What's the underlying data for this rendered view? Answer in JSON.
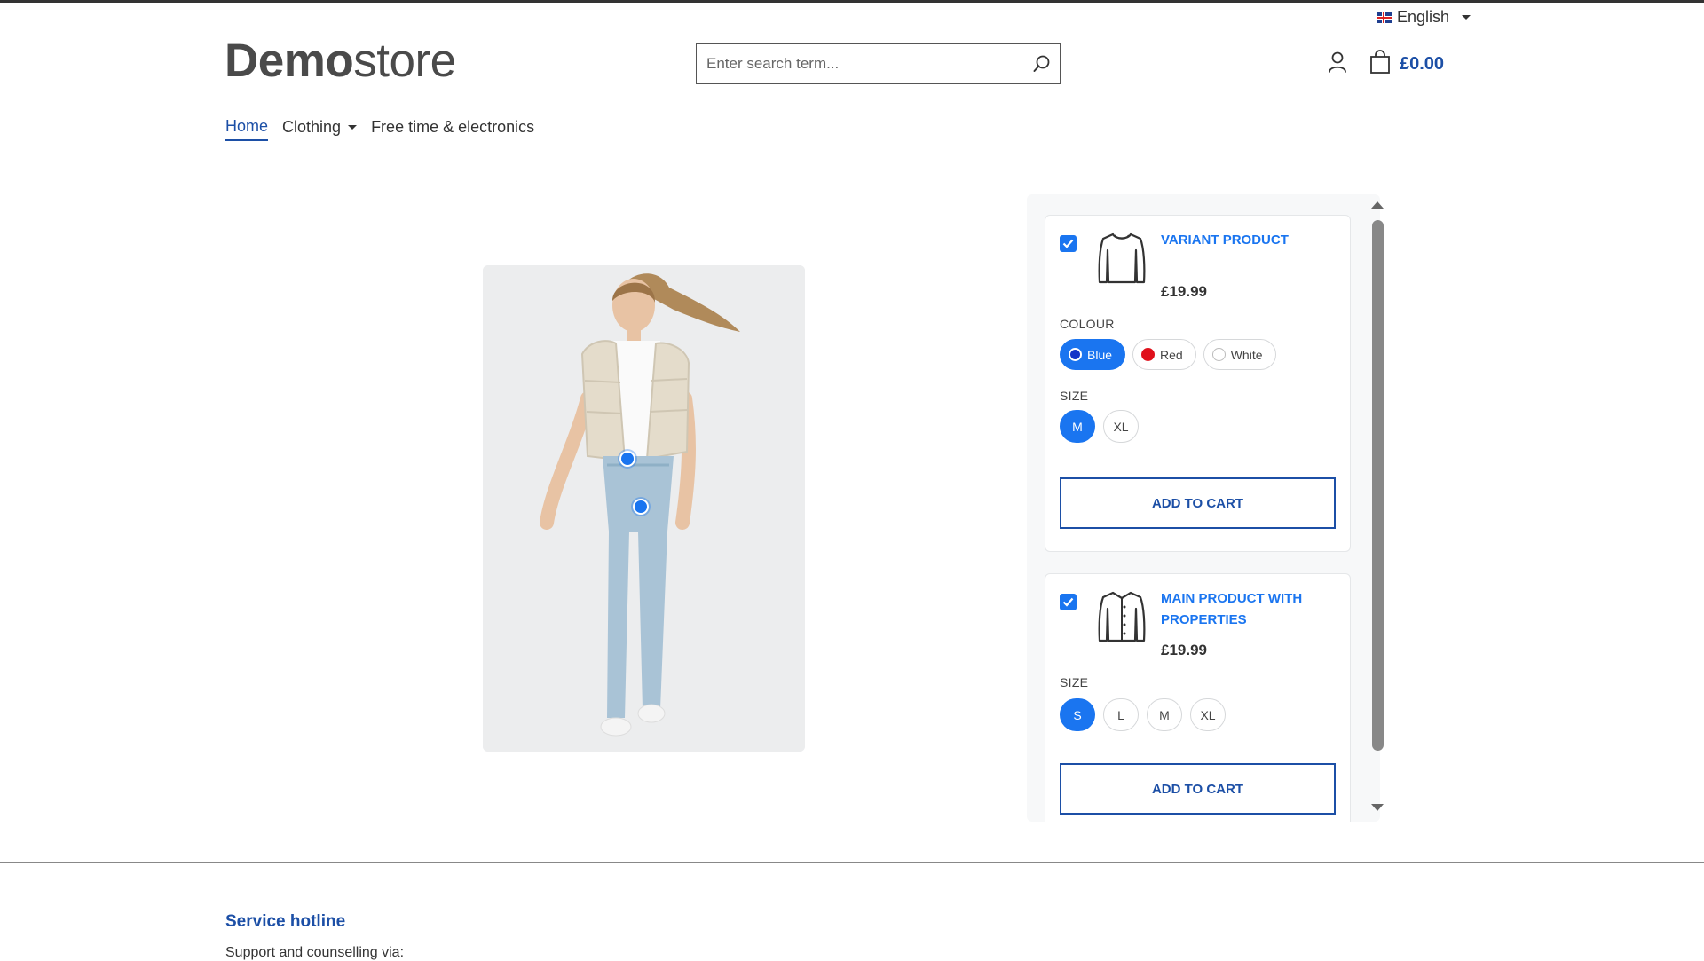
{
  "language": {
    "label": "English",
    "icon": "uk-flag-icon"
  },
  "logo": {
    "bold": "Demo",
    "light": "store"
  },
  "search": {
    "placeholder": "Enter search term...",
    "icon": "search-icon"
  },
  "cart": {
    "total": "£0.00",
    "icon": "bag-icon"
  },
  "account": {
    "icon": "user-icon"
  },
  "nav": {
    "items": [
      {
        "label": "Home",
        "active": true
      },
      {
        "label": "Clothing",
        "dropdown": true
      },
      {
        "label": "Free time & electronics"
      }
    ]
  },
  "products": [
    {
      "name": "VARIANT PRODUCT",
      "price": "£19.99",
      "checked": true,
      "colour_label": "COLOUR",
      "colours": [
        {
          "label": "Blue",
          "hex": "#1433c8",
          "selected": true
        },
        {
          "label": "Red",
          "hex": "#e0101b",
          "selected": false
        },
        {
          "label": "White",
          "hex": "#ffffff",
          "selected": false
        }
      ],
      "size_label": "SIZE",
      "sizes": [
        {
          "label": "M",
          "selected": true
        },
        {
          "label": "XL",
          "selected": false
        }
      ],
      "button": "ADD TO CART"
    },
    {
      "name": "MAIN PRODUCT WITH PROPERTIES",
      "price": "£19.99",
      "checked": true,
      "size_label": "SIZE",
      "sizes": [
        {
          "label": "S",
          "selected": true
        },
        {
          "label": "L",
          "selected": false
        },
        {
          "label": "M",
          "selected": false
        },
        {
          "label": "XL",
          "selected": false
        }
      ],
      "button": "ADD TO CART"
    }
  ],
  "footer": {
    "hotline_title": "Service hotline",
    "support_text": "Support and counselling via:"
  },
  "colors": {
    "brand": "#1c4fa6",
    "accent": "#1a75f0"
  }
}
